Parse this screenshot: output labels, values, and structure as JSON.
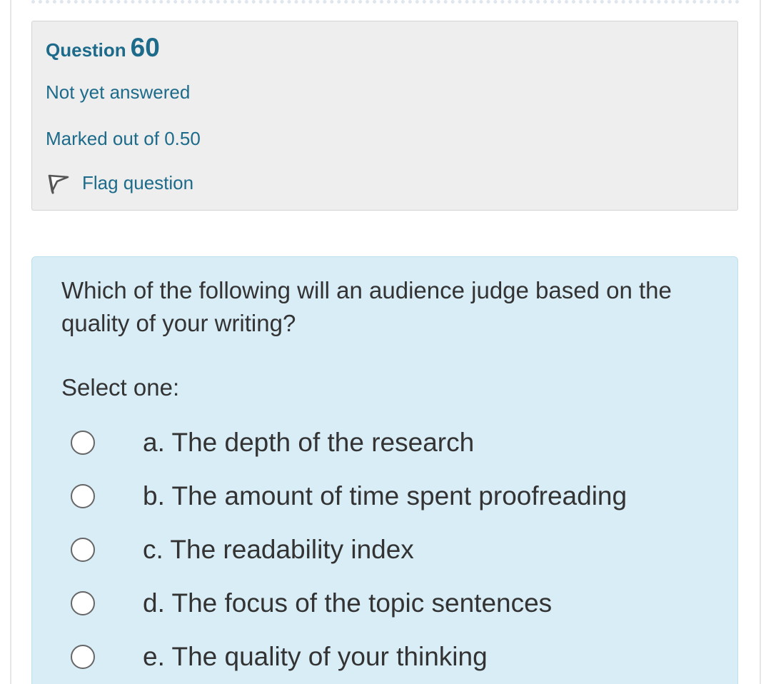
{
  "question": {
    "label": "Question",
    "number": "60",
    "state": "Not yet answered",
    "grade": "Marked out of 0.50",
    "flag_label": "Flag question",
    "flag_icon": "flag-icon",
    "text": "Which of the following will an audience judge based on the quality of your writing?",
    "prompt": "Select one:",
    "options": [
      {
        "label": "a. The depth of the research",
        "selected": false
      },
      {
        "label": "b. The amount of time spent proofreading",
        "selected": false
      },
      {
        "label": "c. The readability index",
        "selected": false
      },
      {
        "label": "d. The focus of the topic sentences",
        "selected": false
      },
      {
        "label": "e. The quality of your thinking",
        "selected": false
      }
    ]
  },
  "colors": {
    "accent": "#1d6b8a",
    "info_background": "#eeeeee",
    "content_background": "#d9edf7",
    "text": "#333333"
  }
}
